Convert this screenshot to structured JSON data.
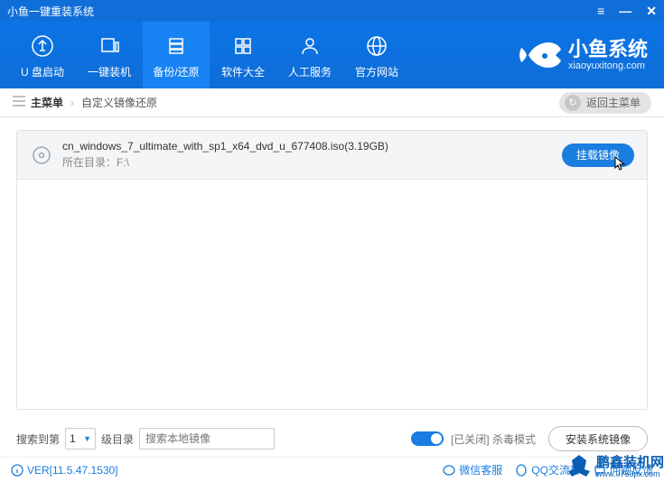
{
  "window": {
    "title": "小鱼一键重装系统"
  },
  "nav": {
    "items": [
      {
        "label": "U 盘启动"
      },
      {
        "label": "一键装机"
      },
      {
        "label": "备份/还原"
      },
      {
        "label": "软件大全"
      },
      {
        "label": "人工服务"
      },
      {
        "label": "官方网站"
      }
    ]
  },
  "brand": {
    "name": "小鱼系统",
    "url": "xiaoyuxitong.com"
  },
  "crumb": {
    "main": "主菜单",
    "current": "自定义镜像还原",
    "return": "返回主菜单"
  },
  "iso": {
    "name": "cn_windows_7_ultimate_with_sp1_x64_dvd_u_677408.iso(3.19GB)",
    "path_label": "所在目录：F:\\",
    "mount": "挂载镜像"
  },
  "footer": {
    "search_to": "搜索到第",
    "page_value": "1",
    "page_unit": "级目录",
    "placeholder": "搜索本地镜像",
    "toggle_label": "[已关闭] 杀毒模式",
    "install": "安装系统镜像"
  },
  "status": {
    "version": "VER[11.5.47.1530]",
    "links": [
      {
        "label": "微信客服"
      },
      {
        "label": "QQ交流群"
      },
      {
        "label": "问题反馈"
      }
    ]
  },
  "watermark": {
    "name": "鹏鑫装机网",
    "url": "www.0753px.com"
  }
}
